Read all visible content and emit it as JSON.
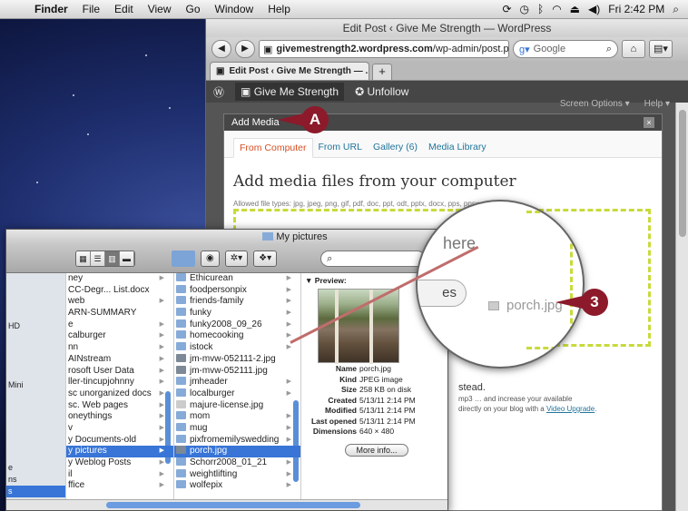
{
  "menubar": {
    "apple_icon": "apple-icon",
    "app_name": "Finder",
    "items": [
      "File",
      "Edit",
      "View",
      "Go",
      "Window",
      "Help"
    ],
    "clock": "Fri 2:42 PM",
    "status_icons": [
      "sync-icon",
      "time-machine-icon",
      "bluetooth-icon",
      "wifi-icon",
      "eject-icon",
      "volume-icon",
      "spotlight-icon"
    ]
  },
  "browser": {
    "window_title": "Edit Post ‹ Give Me Strength — WordPress",
    "url_domain": "givemestrength2.wordpress.com",
    "url_path": "/wp-admin/post.p",
    "search_engine": "Google",
    "tab_title": "Edit Post ‹ Give Me Strength — ...",
    "new_tab": "+"
  },
  "wp_admin_bar": {
    "site_name": "Give Me Strength",
    "unfollow": "Unfollow",
    "screen_options": "Screen Options ▾",
    "help": "Help ▾"
  },
  "add_media_dialog": {
    "title": "Add Media",
    "close": "×",
    "tabs": [
      "From Computer",
      "From URL",
      "Gallery (6)",
      "Media Library"
    ],
    "active_tab": "From Computer",
    "heading": "Add media files from your computer",
    "allowed_types": "Allowed file types: jpg, jpeg, png, gif, pdf, doc, ppt, odt, pptx, docx, pps, ppsx, xls, xlsx.",
    "footer_heading": "stead.",
    "footer_text_1": "mp3",
    "footer_text_2": "and increase your available",
    "footer_text_3": "directly on your blog with a",
    "footer_link": "Video Upgrade"
  },
  "magnifier": {
    "drop_text": "here",
    "button_fragment": "es",
    "dragged_file": "porch.jpg"
  },
  "callouts": {
    "a": "A",
    "b": "3"
  },
  "finder": {
    "title": "My pictures",
    "search_placeholder": "",
    "sidebar": [
      "",
      "",
      "",
      "",
      "HD",
      "",
      "",
      "",
      "",
      "Mini",
      "",
      "",
      "",
      "",
      "",
      "",
      "e",
      "ns",
      "s"
    ],
    "column1": [
      {
        "name": "ney",
        "arrow": true
      },
      {
        "name": "CC-Degr... List.docx",
        "arrow": false
      },
      {
        "name": "web",
        "arrow": true
      },
      {
        "name": "ARN-SUMMARY",
        "arrow": false
      },
      {
        "name": "e",
        "arrow": true
      },
      {
        "name": "calburger",
        "arrow": true
      },
      {
        "name": "nn",
        "arrow": true
      },
      {
        "name": "AINstream",
        "arrow": true
      },
      {
        "name": "rosoft User Data",
        "arrow": true
      },
      {
        "name": "ller-tincupjohnny",
        "arrow": true
      },
      {
        "name": "sc unorganized docs",
        "arrow": true
      },
      {
        "name": "sc. Web pages",
        "arrow": true
      },
      {
        "name": "oneythings",
        "arrow": true
      },
      {
        "name": "v",
        "arrow": true
      },
      {
        "name": "y Documents-old",
        "arrow": true
      },
      {
        "name": "y pictures",
        "arrow": true,
        "selected": true
      },
      {
        "name": "y Weblog Posts",
        "arrow": true
      },
      {
        "name": "il",
        "arrow": true
      },
      {
        "name": "ffice",
        "arrow": true
      }
    ],
    "column2": [
      {
        "name": "Ethicurean",
        "icon": "folder-icon",
        "arrow": true
      },
      {
        "name": "foodpersonpix",
        "icon": "folder-icon",
        "arrow": true
      },
      {
        "name": "friends-family",
        "icon": "folder-icon",
        "arrow": true
      },
      {
        "name": "funky",
        "icon": "folder-icon",
        "arrow": true
      },
      {
        "name": "funky2008_09_26",
        "icon": "folder-icon",
        "arrow": true
      },
      {
        "name": "homecooking",
        "icon": "folder-icon",
        "arrow": true
      },
      {
        "name": "istock",
        "icon": "folder-icon",
        "arrow": true
      },
      {
        "name": "jm-mvw-052111-2.jpg",
        "icon": "image-icon",
        "arrow": false
      },
      {
        "name": "jm-mvw-052111.jpg",
        "icon": "image-icon",
        "arrow": false
      },
      {
        "name": "jmheader",
        "icon": "folder-icon",
        "arrow": true
      },
      {
        "name": "localburger",
        "icon": "folder-icon",
        "arrow": true
      },
      {
        "name": "majure-license.jpg",
        "icon": "document-icon",
        "arrow": false
      },
      {
        "name": "mom",
        "icon": "folder-icon",
        "arrow": true
      },
      {
        "name": "mug",
        "icon": "folder-icon",
        "arrow": true
      },
      {
        "name": "pixfromemilyswedding",
        "icon": "folder-icon",
        "arrow": true
      },
      {
        "name": "porch.jpg",
        "icon": "image-icon",
        "arrow": false,
        "selected": true
      },
      {
        "name": "Schorr2008_01_21",
        "icon": "folder-icon",
        "arrow": true
      },
      {
        "name": "weightlifting",
        "icon": "folder-icon",
        "arrow": true
      },
      {
        "name": "wolfepix",
        "icon": "folder-icon",
        "arrow": true
      }
    ],
    "preview": {
      "label": "▼ Preview:",
      "meta": [
        {
          "k": "Name",
          "v": "porch.jpg"
        },
        {
          "k": "Kind",
          "v": "JPEG image"
        },
        {
          "k": "Size",
          "v": "258 KB on disk"
        },
        {
          "k": "Created",
          "v": "5/13/11 2:14 PM"
        },
        {
          "k": "Modified",
          "v": "5/13/11 2:14 PM"
        },
        {
          "k": "Last opened",
          "v": "5/13/11 2:14 PM"
        },
        {
          "k": "Dimensions",
          "v": "640 × 480"
        }
      ],
      "more_info": "More info..."
    }
  },
  "colors": {
    "callout": "#8c1a2a",
    "selection": "#3875d7",
    "dropzone_dash": "#c8da3a",
    "wp_dark": "#464646",
    "link": "#21759b",
    "active_tab": "#d54e21"
  }
}
